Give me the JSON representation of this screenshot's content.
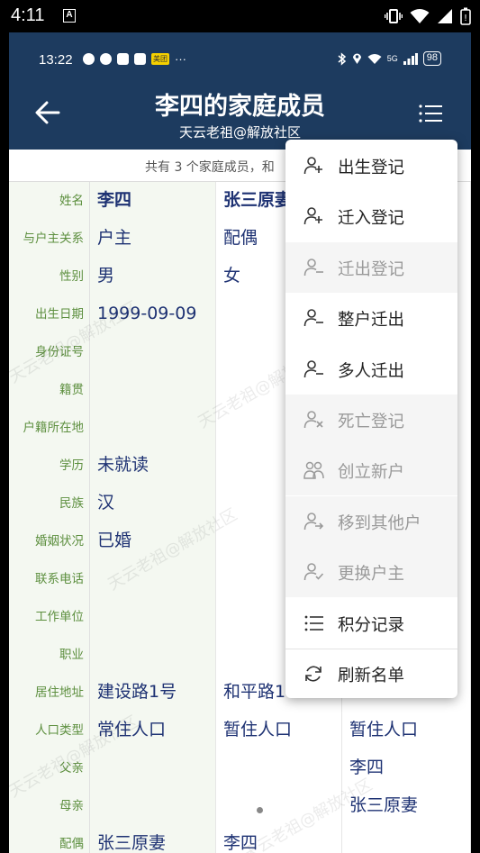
{
  "outer_status": {
    "time": "4:11",
    "a_badge": "A"
  },
  "app_status": {
    "time": "13:22",
    "meituan": "美团",
    "dots": "···",
    "network": "5G",
    "battery": "98"
  },
  "header": {
    "title": "李四的家庭成员",
    "subtitle": "天云老祖@解放社区"
  },
  "summary": "共有 3 个家庭成员，和",
  "watermark": "天云老祖@解放社区",
  "table": {
    "rows": [
      {
        "label": "姓名",
        "c1": "李四",
        "c2": "张三原妻",
        "c3": ""
      },
      {
        "label": "与户主关系",
        "c1": "户主",
        "c2": "配偶",
        "c3": ""
      },
      {
        "label": "性别",
        "c1": "男",
        "c2": "女",
        "c3": ""
      },
      {
        "label": "出生日期",
        "c1": "1999-09-09",
        "c2": "",
        "c3": ""
      },
      {
        "label": "身份证号",
        "c1": "",
        "c2": "",
        "c3": ""
      },
      {
        "label": "籍贯",
        "c1": "",
        "c2": "",
        "c3": ""
      },
      {
        "label": "户籍所在地",
        "c1": "",
        "c2": "",
        "c3": ""
      },
      {
        "label": "学历",
        "c1": "未就读",
        "c2": "",
        "c3": ""
      },
      {
        "label": "民族",
        "c1": "汉",
        "c2": "",
        "c3": ""
      },
      {
        "label": "婚姻状况",
        "c1": "已婚",
        "c2": "",
        "c3": ""
      },
      {
        "label": "联系电话",
        "c1": "",
        "c2": "",
        "c3": ""
      },
      {
        "label": "工作单位",
        "c1": "",
        "c2": "",
        "c3": ""
      },
      {
        "label": "职业",
        "c1": "",
        "c2": "",
        "c3": ""
      },
      {
        "label": "居住地址",
        "c1": "建设路1号",
        "c2": "和平路1",
        "c3": ""
      },
      {
        "label": "人口类型",
        "c1": "常住人口",
        "c2": "暂住人口",
        "c3": "暂住人口"
      },
      {
        "label": "父亲",
        "c1": "",
        "c2": "",
        "c3": "李四"
      },
      {
        "label": "母亲",
        "c1": "",
        "c2": "",
        "c3": "张三原妻"
      },
      {
        "label": "配偶",
        "c1": "张三原妻",
        "c2": "李四",
        "c3": ""
      }
    ]
  },
  "menu": {
    "items": [
      {
        "label": "出生登记",
        "icon": "person-add-icon",
        "enabled": true
      },
      {
        "label": "迁入登记",
        "icon": "person-add-icon",
        "enabled": true
      },
      {
        "label": "迁出登记",
        "icon": "person-remove-icon",
        "enabled": false
      },
      {
        "label": "整户迁出",
        "icon": "person-remove-icon",
        "enabled": true
      },
      {
        "label": "多人迁出",
        "icon": "person-remove-icon",
        "enabled": true
      },
      {
        "label": "死亡登记",
        "icon": "person-x-icon",
        "enabled": false
      },
      {
        "label": "创立新户",
        "icon": "people-icon",
        "enabled": false
      },
      {
        "label": "移到其他户",
        "icon": "person-arrow-icon",
        "enabled": false
      },
      {
        "label": "更换户主",
        "icon": "person-check-icon",
        "enabled": false
      },
      {
        "label": "积分记录",
        "icon": "list-icon",
        "enabled": true
      },
      {
        "label": "刷新名单",
        "icon": "refresh-icon",
        "enabled": true
      }
    ]
  }
}
